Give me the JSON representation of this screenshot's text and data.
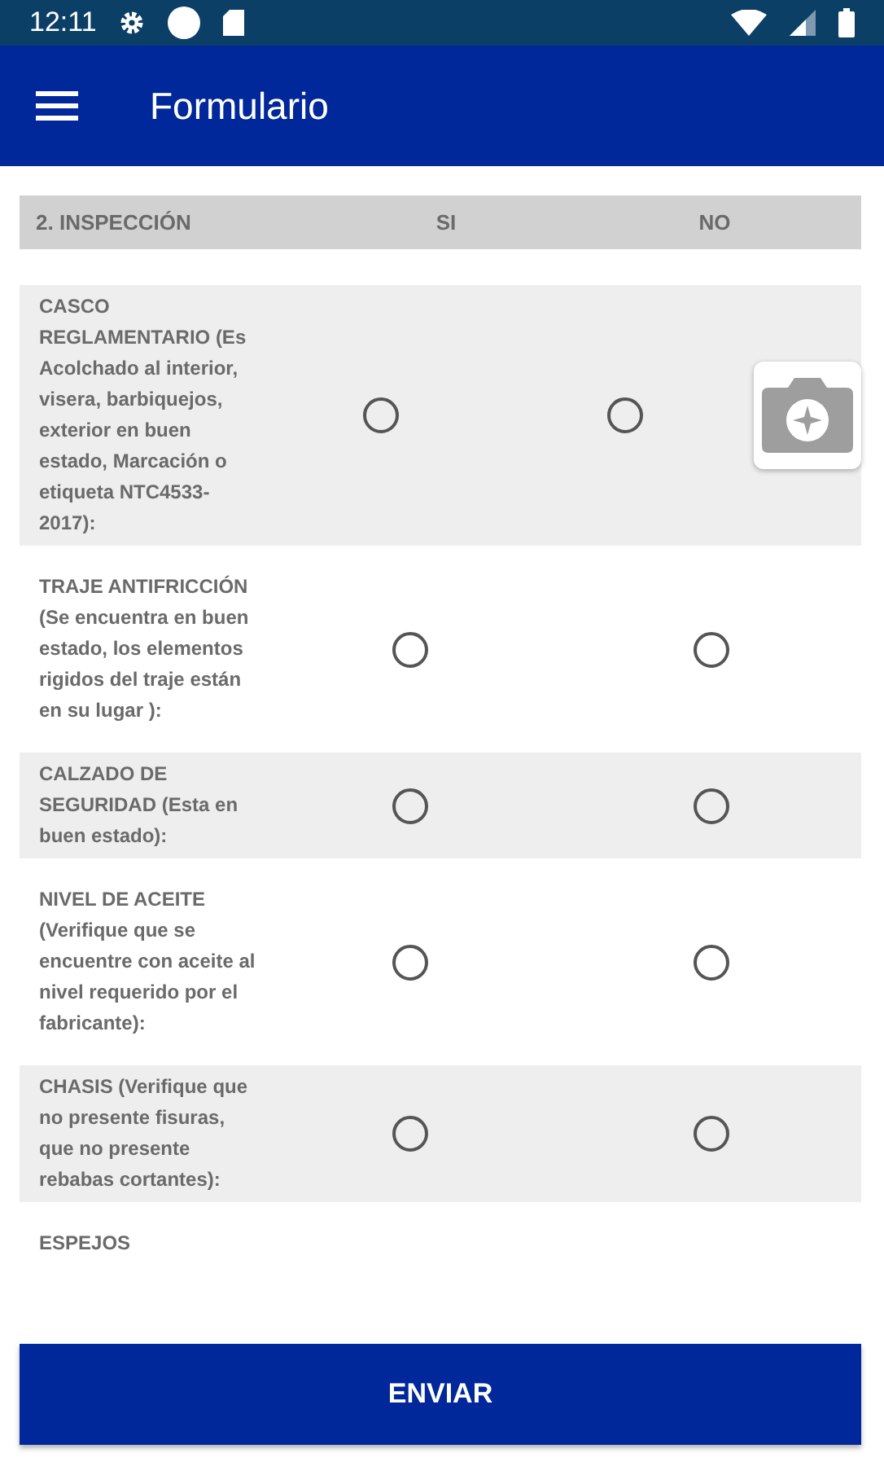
{
  "status_bar": {
    "time": "12:11"
  },
  "app_bar": {
    "title": "Formulario"
  },
  "section_header": {
    "title": "2. INSPECCIÓN",
    "columns": [
      "SI",
      "NO"
    ]
  },
  "items": [
    {
      "kind": "photo",
      "label": "CASCO REGLAMENTARIO (Es Acolchado al interior, visera, barbiquejos, exterior en buen estado, Marcación o etiqueta NTC4533-2017):",
      "options": [
        {
          "selected": false
        },
        {
          "selected": false
        }
      ]
    },
    {
      "kind": "plain",
      "label": "TRAJE ANTIFRICCIÓN (Se encuentra en buen estado, los elementos rigidos del traje están en su lugar ):",
      "options": [
        {
          "selected": false
        },
        {
          "selected": false
        }
      ]
    },
    {
      "kind": "plain",
      "label": "CALZADO DE SEGURIDAD (Esta en buen estado):",
      "options": [
        {
          "selected": false
        },
        {
          "selected": false
        }
      ]
    },
    {
      "kind": "plain",
      "label": "NIVEL DE ACEITE (Verifique que se encuentre con aceite al nivel requerido por el fabricante):",
      "options": [
        {
          "selected": false
        },
        {
          "selected": false
        }
      ]
    },
    {
      "kind": "plain",
      "label": "CHASIS (Verifique que no presente fisuras, que no presente rebabas cortantes):",
      "options": [
        {
          "selected": false
        },
        {
          "selected": false
        }
      ]
    },
    {
      "kind": "plain",
      "label": "ESPEJOS"
    }
  ],
  "submit_button": "ENVIAR"
}
